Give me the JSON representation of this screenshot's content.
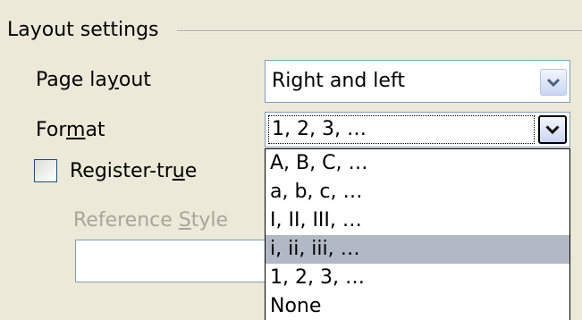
{
  "section": {
    "title": "Layout settings"
  },
  "page_layout": {
    "label_pre": "Page la",
    "label_mnemonic": "y",
    "label_post": "out",
    "value": "Right and left"
  },
  "format": {
    "label_pre": "For",
    "label_mnemonic": "m",
    "label_post": "at",
    "value": "1, 2, 3, …",
    "options": [
      "A, B, C, …",
      "a, b, c, …",
      "I, II, III, …",
      "i, ii, iii, …",
      "1, 2, 3, …",
      "None"
    ],
    "highlighted_option": "i, ii, iii, …"
  },
  "register_true": {
    "label_pre": "Register-tr",
    "label_mnemonic": "u",
    "label_post": "e",
    "checked": false
  },
  "reference_style": {
    "label_pre": "Reference ",
    "label_mnemonic": "S",
    "label_post": "tyle",
    "value": ""
  },
  "colors": {
    "dialog_bg": "#ece9d8",
    "highlight": "#b3b8c6",
    "disabled_text": "#a8a69a",
    "input_border": "#7f9db9"
  },
  "icons": {
    "dropdown": "chevron-down-icon"
  }
}
